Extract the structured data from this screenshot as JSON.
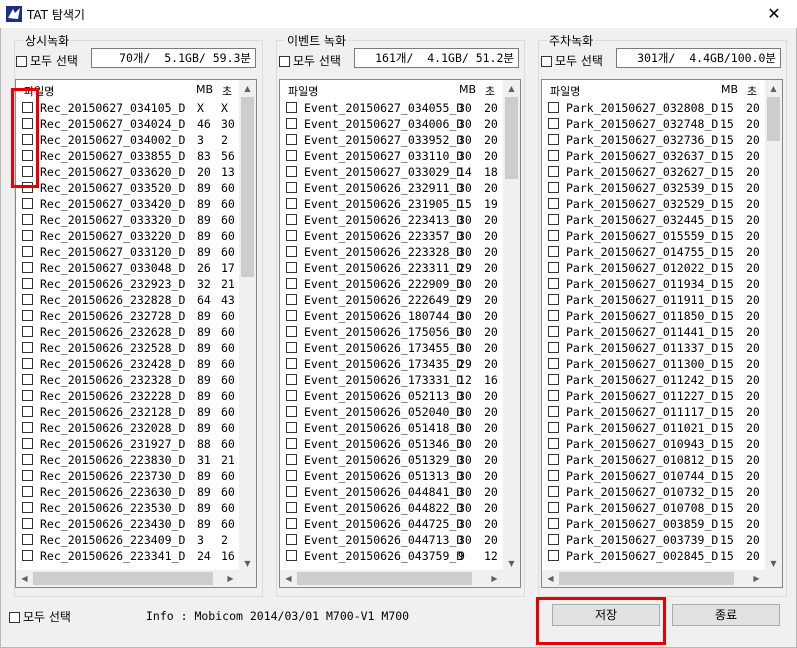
{
  "window": {
    "title": "TAT 탐색기",
    "close_glyph": "✕"
  },
  "panels": [
    {
      "title": "상시녹화",
      "select_all": "모두 선택",
      "summary": "70개/  5.1GB/ 59.3분",
      "col_name": "파일명",
      "col_mb": "MB",
      "col_sec": "초",
      "rows": [
        [
          "Rec_20150627_034105_D",
          "X",
          "X"
        ],
        [
          "Rec_20150627_034024_D",
          "46",
          "30"
        ],
        [
          "Rec_20150627_034002_D",
          "3",
          "2"
        ],
        [
          "Rec_20150627_033855_D",
          "83",
          "56"
        ],
        [
          "Rec_20150627_033620_D",
          "20",
          "13"
        ],
        [
          "Rec_20150627_033520_D",
          "89",
          "60"
        ],
        [
          "Rec_20150627_033420_D",
          "89",
          "60"
        ],
        [
          "Rec_20150627_033320_D",
          "89",
          "60"
        ],
        [
          "Rec_20150627_033220_D",
          "89",
          "60"
        ],
        [
          "Rec_20150627_033120_D",
          "89",
          "60"
        ],
        [
          "Rec_20150627_033048_D",
          "26",
          "17"
        ],
        [
          "Rec_20150626_232923_D",
          "32",
          "21"
        ],
        [
          "Rec_20150626_232828_D",
          "64",
          "43"
        ],
        [
          "Rec_20150626_232728_D",
          "89",
          "60"
        ],
        [
          "Rec_20150626_232628_D",
          "89",
          "60"
        ],
        [
          "Rec_20150626_232528_D",
          "89",
          "60"
        ],
        [
          "Rec_20150626_232428_D",
          "89",
          "60"
        ],
        [
          "Rec_20150626_232328_D",
          "89",
          "60"
        ],
        [
          "Rec_20150626_232228_D",
          "89",
          "60"
        ],
        [
          "Rec_20150626_232128_D",
          "89",
          "60"
        ],
        [
          "Rec_20150626_232028_D",
          "89",
          "60"
        ],
        [
          "Rec_20150626_231927_D",
          "88",
          "60"
        ],
        [
          "Rec_20150626_223830_D",
          "31",
          "21"
        ],
        [
          "Rec_20150626_223730_D",
          "89",
          "60"
        ],
        [
          "Rec_20150626_223630_D",
          "89",
          "60"
        ],
        [
          "Rec_20150626_223530_D",
          "89",
          "60"
        ],
        [
          "Rec_20150626_223430_D",
          "89",
          "60"
        ],
        [
          "Rec_20150626_223409_D",
          "3",
          "2"
        ],
        [
          "Rec_20150626_223341_D",
          "24",
          "16"
        ]
      ]
    },
    {
      "title": "이벤트 녹화",
      "select_all": "모두 선택",
      "summary": "161개/  4.1GB/ 51.2분",
      "col_name": "파일명",
      "col_mb": "MB",
      "col_sec": "초",
      "rows": [
        [
          "Event_20150627_034055_D",
          "30",
          "20"
        ],
        [
          "Event_20150627_034006_D",
          "30",
          "20"
        ],
        [
          "Event_20150627_033952_D",
          "30",
          "20"
        ],
        [
          "Event_20150627_033110_D",
          "30",
          "20"
        ],
        [
          "Event_20150627_033029_D",
          "14",
          "18"
        ],
        [
          "Event_20150626_232911_D",
          "30",
          "20"
        ],
        [
          "Event_20150626_231905_D",
          "15",
          "19"
        ],
        [
          "Event_20150626_223413_D",
          "30",
          "20"
        ],
        [
          "Event_20150626_223357_D",
          "30",
          "20"
        ],
        [
          "Event_20150626_223328_D",
          "30",
          "20"
        ],
        [
          "Event_20150626_223311_D",
          "29",
          "20"
        ],
        [
          "Event_20150626_222909_D",
          "30",
          "20"
        ],
        [
          "Event_20150626_222649_D",
          "29",
          "20"
        ],
        [
          "Event_20150626_180744_D",
          "30",
          "20"
        ],
        [
          "Event_20150626_175056_D",
          "30",
          "20"
        ],
        [
          "Event_20150626_173455_D",
          "30",
          "20"
        ],
        [
          "Event_20150626_173435_D",
          "29",
          "20"
        ],
        [
          "Event_20150626_173331_D",
          "12",
          "16"
        ],
        [
          "Event_20150626_052113_D",
          "30",
          "20"
        ],
        [
          "Event_20150626_052040_D",
          "30",
          "20"
        ],
        [
          "Event_20150626_051418_D",
          "30",
          "20"
        ],
        [
          "Event_20150626_051346_D",
          "30",
          "20"
        ],
        [
          "Event_20150626_051329_D",
          "30",
          "20"
        ],
        [
          "Event_20150626_051313_D",
          "30",
          "20"
        ],
        [
          "Event_20150626_044841_D",
          "30",
          "20"
        ],
        [
          "Event_20150626_044822_D",
          "30",
          "20"
        ],
        [
          "Event_20150626_044725_D",
          "30",
          "20"
        ],
        [
          "Event_20150626_044713_D",
          "30",
          "20"
        ],
        [
          "Event_20150626_043759_D",
          "9",
          "12"
        ]
      ]
    },
    {
      "title": "주차녹화",
      "select_all": "모두 선택",
      "summary": "301개/  4.4GB/100.0분",
      "col_name": "파일명",
      "col_mb": "MB",
      "col_sec": "초",
      "rows": [
        [
          "Park_20150627_032808_D",
          "15",
          "20"
        ],
        [
          "Park_20150627_032748_D",
          "15",
          "20"
        ],
        [
          "Park_20150627_032736_D",
          "15",
          "20"
        ],
        [
          "Park_20150627_032637_D",
          "15",
          "20"
        ],
        [
          "Park_20150627_032627_D",
          "15",
          "20"
        ],
        [
          "Park_20150627_032539_D",
          "15",
          "20"
        ],
        [
          "Park_20150627_032529_D",
          "15",
          "20"
        ],
        [
          "Park_20150627_032445_D",
          "15",
          "20"
        ],
        [
          "Park_20150627_015559_D",
          "15",
          "20"
        ],
        [
          "Park_20150627_014755_D",
          "15",
          "20"
        ],
        [
          "Park_20150627_012022_D",
          "15",
          "20"
        ],
        [
          "Park_20150627_011934_D",
          "15",
          "20"
        ],
        [
          "Park_20150627_011911_D",
          "15",
          "20"
        ],
        [
          "Park_20150627_011850_D",
          "15",
          "20"
        ],
        [
          "Park_20150627_011441_D",
          "15",
          "20"
        ],
        [
          "Park_20150627_011337_D",
          "15",
          "20"
        ],
        [
          "Park_20150627_011300_D",
          "15",
          "20"
        ],
        [
          "Park_20150627_011242_D",
          "15",
          "20"
        ],
        [
          "Park_20150627_011227_D",
          "15",
          "20"
        ],
        [
          "Park_20150627_011117_D",
          "15",
          "20"
        ],
        [
          "Park_20150627_011021_D",
          "15",
          "20"
        ],
        [
          "Park_20150627_010943_D",
          "15",
          "20"
        ],
        [
          "Park_20150627_010812_D",
          "15",
          "20"
        ],
        [
          "Park_20150627_010744_D",
          "15",
          "20"
        ],
        [
          "Park_20150627_010732_D",
          "15",
          "20"
        ],
        [
          "Park_20150627_010708_D",
          "15",
          "20"
        ],
        [
          "Park_20150627_003859_D",
          "15",
          "20"
        ],
        [
          "Park_20150627_003739_D",
          "15",
          "20"
        ],
        [
          "Park_20150627_002845_D",
          "15",
          "20"
        ]
      ]
    }
  ],
  "footer": {
    "select_all": "모두 선택",
    "info": "Info : Mobicom 2014/03/01 M700-V1 M700",
    "save_label": "저장",
    "exit_label": "종료"
  },
  "colors": {
    "highlight": "#e60000",
    "window_bg": "#f0f0f0"
  }
}
